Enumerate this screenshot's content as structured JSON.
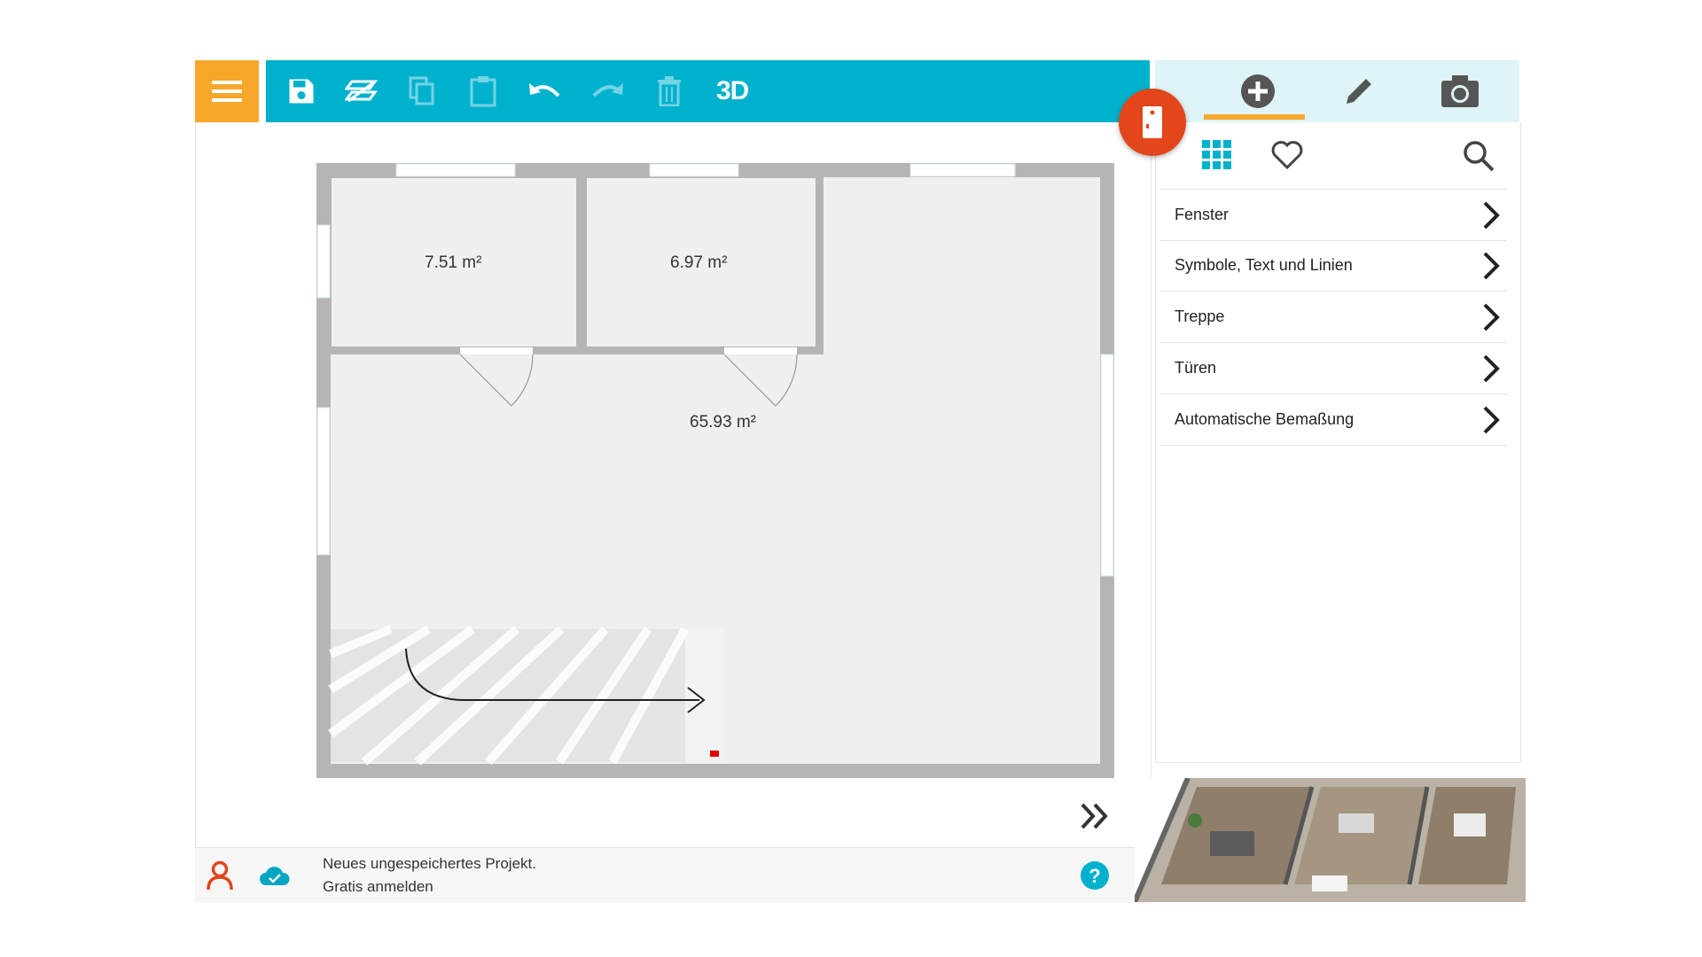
{
  "toolbar": {
    "mode_label": "3D",
    "icons": [
      "menu-icon",
      "save-icon",
      "layers-icon",
      "copy-icon",
      "paste-icon",
      "undo-icon",
      "redo-icon",
      "trash-icon"
    ]
  },
  "right_tabs": [
    "add-icon",
    "pencil-icon",
    "camera-icon"
  ],
  "panel": {
    "filters": [
      "grid-icon",
      "heart-icon",
      "search-icon"
    ],
    "categories": [
      {
        "label": "Fenster"
      },
      {
        "label": "Symbole, Text und Linien"
      },
      {
        "label": "Treppe"
      },
      {
        "label": "Türen"
      },
      {
        "label": "Automatische Bemaßung"
      }
    ]
  },
  "floorplan": {
    "rooms": [
      {
        "area": "7.51 m²"
      },
      {
        "area": "6.97 m²"
      },
      {
        "area": "65.93 m²"
      }
    ]
  },
  "status": {
    "line1": "Neues ungespeichertes Projekt.",
    "line2": "Gratis anmelden"
  },
  "colors": {
    "accent": "#00b1cd",
    "menu": "#f7a72a",
    "fab": "#e2461a",
    "tab_bg": "#def4f6"
  }
}
